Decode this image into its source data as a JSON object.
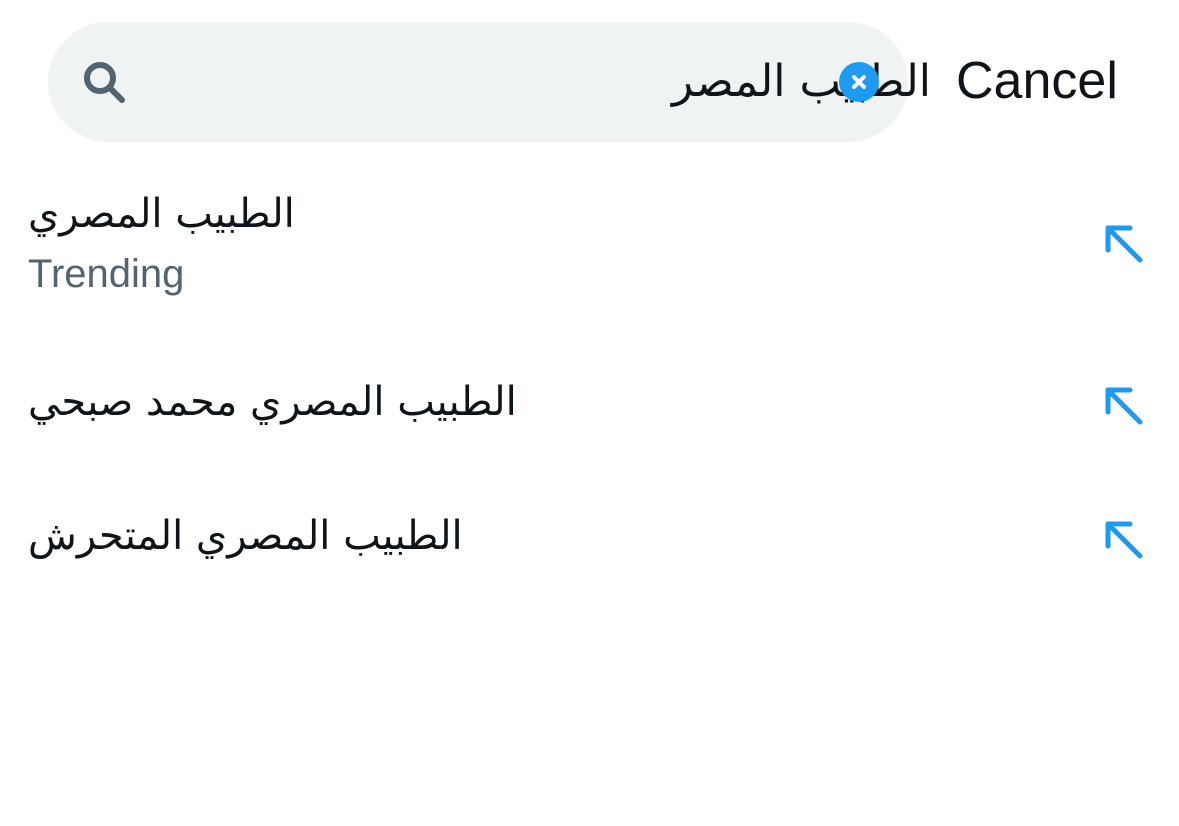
{
  "search": {
    "query": "الطبيب  المصر",
    "cancel_label": "Cancel"
  },
  "suggestions": [
    {
      "label": "الطبيب المصري",
      "subtitle": "Trending"
    },
    {
      "label": "الطبيب المصري محمد صبحي"
    },
    {
      "label": "الطبيب المصري المتحرش"
    }
  ],
  "icons": {
    "search": "search-icon",
    "clear": "close-circle-icon",
    "fill_query": "arrow-up-left-icon"
  },
  "colors": {
    "accent": "#1d9bf0",
    "search_bg": "#eff3f4",
    "secondary_text": "#536471",
    "primary_text": "#0f1419",
    "icon_gray": "#536471"
  }
}
